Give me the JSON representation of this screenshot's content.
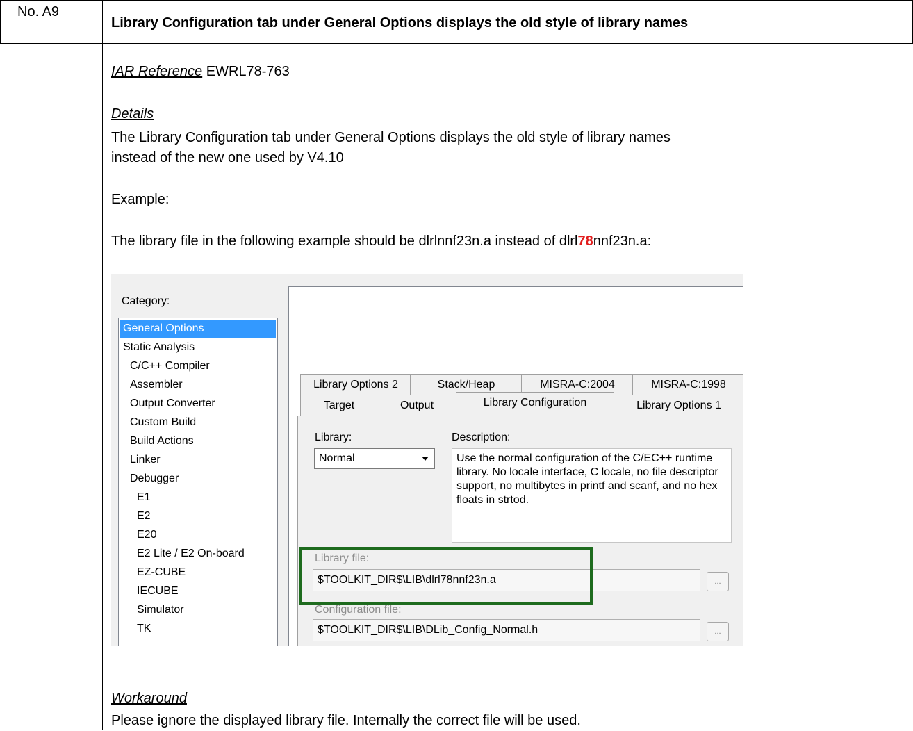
{
  "issue": {
    "number": "No. A9",
    "title": "Library Configuration tab under General Options displays the old style of library names"
  },
  "reference": {
    "label": "IAR Reference",
    "value": " EWRL78-763"
  },
  "details": {
    "heading": "Details",
    "line1": "The Library Configuration tab under General Options displays the old style of library names",
    "line2": "instead of the new one used by V4.10"
  },
  "example": {
    "label": "Example:",
    "sentence_start": "The library file in the following example should be dlrlnnf23n.a instead of dlrl",
    "highlight": "78",
    "sentence_end": "nnf23n.a:"
  },
  "dialog": {
    "category_label": "Category:",
    "categories": [
      "General Options",
      "Static Analysis",
      "C/C++ Compiler",
      "Assembler",
      "Output Converter",
      "Custom Build",
      "Build Actions",
      "Linker",
      "Debugger",
      "E1",
      "E2",
      "E20",
      "E2 Lite / E2 On-board",
      "EZ-CUBE",
      "IECUBE",
      "Simulator",
      "TK"
    ],
    "tabs_row1": [
      "Library Options 2",
      "Stack/Heap",
      "MISRA-C:2004",
      "MISRA-C:1998"
    ],
    "tabs_row2": [
      "Target",
      "Output",
      "Library Configuration",
      "Library Options 1"
    ],
    "library_label": "Library:",
    "library_value": "Normal",
    "description_label": "Description:",
    "description_text": "Use the normal configuration of the C/EC++ runtime library. No locale interface, C locale, no file descriptor support, no multibytes in printf and scanf, and no hex floats in strtod.",
    "library_file_label": "Library file:",
    "library_file_value": "$TOOLKIT_DIR$\\LIB\\dlrl78nnf23n.a",
    "config_file_label": "Configuration file:",
    "config_file_value": "$TOOLKIT_DIR$\\LIB\\DLib_Config_Normal.h",
    "browse_label": "...",
    "colors": {
      "selection": "#3399ff",
      "highlight_box": "#1e6b1e",
      "highlight_text": "#e11d1d"
    }
  },
  "workaround": {
    "heading": "Workaround",
    "text": "Please ignore the displayed library file. Internally the correct file will be used."
  }
}
